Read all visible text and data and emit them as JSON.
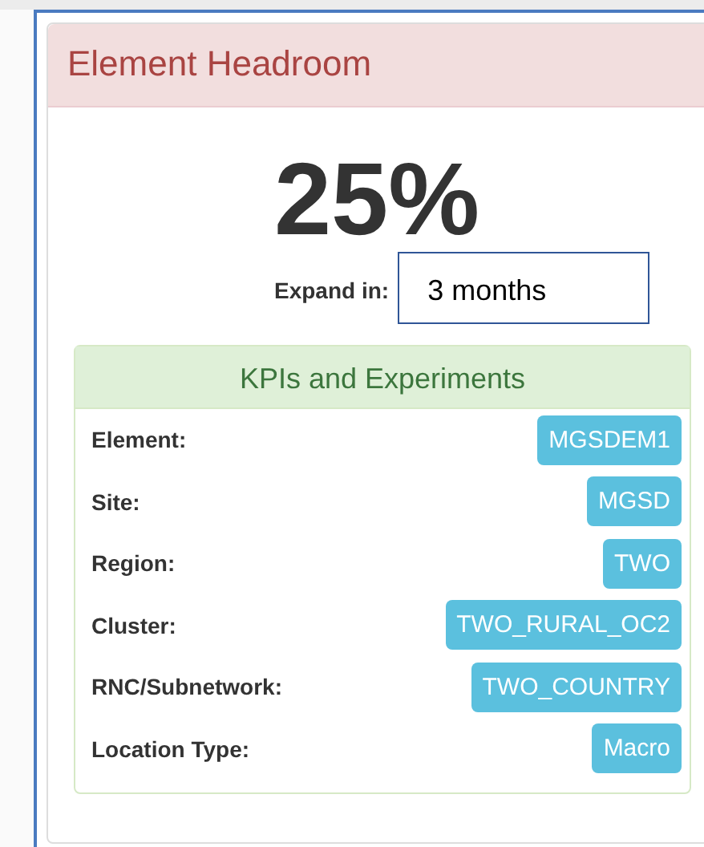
{
  "panel": {
    "title": "Element Headroom"
  },
  "headroom": {
    "value": "25%",
    "expand_label": "Expand in:",
    "expand_value": "3 months"
  },
  "kpis": {
    "title": "KPIs and Experiments",
    "rows": [
      {
        "label": "Element:",
        "value": "MGSDEM1"
      },
      {
        "label": "Site:",
        "value": "MGSD"
      },
      {
        "label": "Region:",
        "value": "TWO"
      },
      {
        "label": "Cluster:",
        "value": "TWO_RURAL_OC2"
      },
      {
        "label": "RNC/Subnetwork:",
        "value": "TWO_COUNTRY"
      },
      {
        "label": "Location Type:",
        "value": "Macro"
      }
    ]
  }
}
